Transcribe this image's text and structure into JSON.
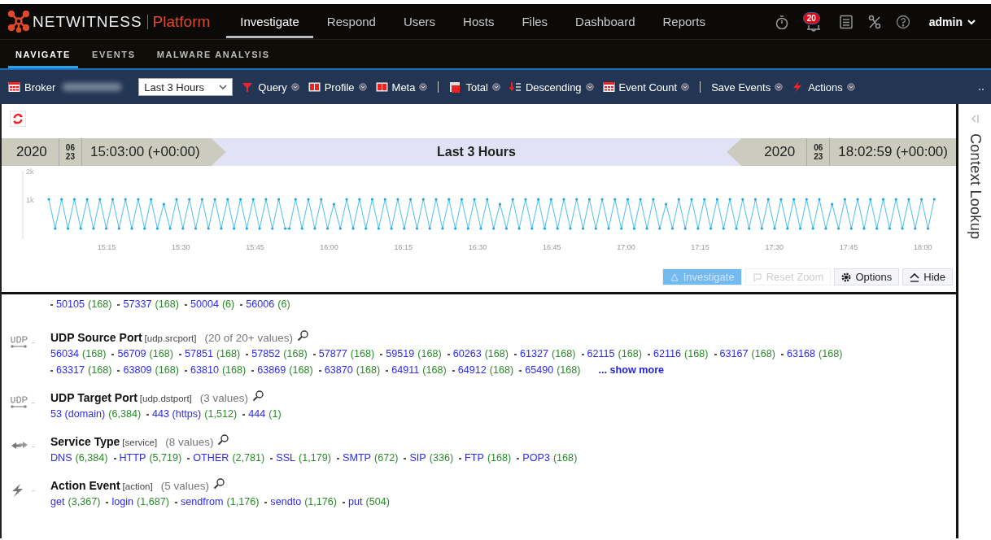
{
  "header": {
    "brand": "NETWITNESS",
    "product": "Platform",
    "nav": [
      {
        "label": "Investigate",
        "selected": true
      },
      {
        "label": "Respond",
        "selected": false
      },
      {
        "label": "Users",
        "selected": false
      },
      {
        "label": "Hosts",
        "selected": false
      },
      {
        "label": "Files",
        "selected": false
      },
      {
        "label": "Dashboard",
        "selected": false
      },
      {
        "label": "Reports",
        "selected": false
      }
    ],
    "notification_count": "20",
    "user": "admin"
  },
  "subnav": [
    {
      "label": "NAVIGATE",
      "selected": true
    },
    {
      "label": "EVENTS",
      "selected": false
    },
    {
      "label": "MALWARE ANALYSIS",
      "selected": false
    }
  ],
  "toolbar": {
    "broker_label": "Broker",
    "time_range": "Last 3 Hours",
    "items": [
      {
        "kind": "funnel",
        "label": "Query"
      },
      {
        "kind": "profile",
        "label": "Profile"
      },
      {
        "kind": "profile",
        "label": "Meta"
      },
      {
        "kind": "separator"
      },
      {
        "kind": "total",
        "label": "Total"
      },
      {
        "kind": "sort",
        "label": "Descending"
      },
      {
        "kind": "grid",
        "label": "Event Count"
      },
      {
        "kind": "separator"
      },
      {
        "kind": "plain",
        "label": "Save Events"
      },
      {
        "kind": "bolt",
        "label": "Actions"
      }
    ]
  },
  "timeline": {
    "start": {
      "year": "2020",
      "month": "06",
      "day": "23",
      "time": "15:03:00 (+00:00)"
    },
    "range_label": "Last 3 Hours",
    "end": {
      "year": "2020",
      "month": "06",
      "day": "23",
      "time": "18:02:59 (+00:00)"
    },
    "y_ticks": [
      "2k",
      "1k"
    ],
    "x_ticks": [
      "15:15",
      "15:30",
      "15:45",
      "16:00",
      "16:15",
      "16:30",
      "16:45",
      "17:00",
      "17:15",
      "17:30",
      "17:45",
      "18:00"
    ],
    "buttons": [
      {
        "kind": "investigate",
        "label": "Investigate",
        "disabled": true,
        "primary": true
      },
      {
        "kind": "reset",
        "label": "Reset Zoom",
        "disabled": true,
        "primary": false
      },
      {
        "kind": "gear",
        "label": "Options",
        "disabled": false,
        "primary": false
      },
      {
        "kind": "hide",
        "label": "Hide",
        "disabled": false,
        "primary": false
      }
    ]
  },
  "meta_groups": [
    {
      "kind": "continuation",
      "values": [
        {
          "value": "50105",
          "count": "(168)"
        },
        {
          "value": "57337",
          "count": "(168)"
        },
        {
          "value": "50004",
          "count": "(6)"
        },
        {
          "value": "56006",
          "count": "(6)"
        }
      ]
    },
    {
      "kind": "udp",
      "title": "UDP Source Port",
      "key": "[udp.srcport]",
      "count": "(20 of 20+ values)",
      "values": [
        {
          "value": "56034",
          "count": "(168)"
        },
        {
          "value": "56709",
          "count": "(168)"
        },
        {
          "value": "57851",
          "count": "(168)"
        },
        {
          "value": "57852",
          "count": "(168)"
        },
        {
          "value": "57877",
          "count": "(168)"
        },
        {
          "value": "59519",
          "count": "(168)"
        },
        {
          "value": "60263",
          "count": "(168)"
        },
        {
          "value": "61327",
          "count": "(168)"
        },
        {
          "value": "62115",
          "count": "(168)"
        },
        {
          "value": "62116",
          "count": "(168)"
        },
        {
          "value": "63167",
          "count": "(168)"
        },
        {
          "value": "63168",
          "count": "(168)"
        },
        {
          "value": "63317",
          "count": "(168)"
        },
        {
          "value": "63809",
          "count": "(168)"
        },
        {
          "value": "63810",
          "count": "(168)"
        },
        {
          "value": "63869",
          "count": "(168)"
        },
        {
          "value": "63870",
          "count": "(168)"
        },
        {
          "value": "64911",
          "count": "(168)"
        },
        {
          "value": "64912",
          "count": "(168)"
        },
        {
          "value": "65490",
          "count": "(168)"
        }
      ],
      "more": "... show more"
    },
    {
      "kind": "udp",
      "title": "UDP Target Port",
      "key": "[udp.dstport]",
      "count": "(3 values)",
      "values": [
        {
          "value": "53 (domain)",
          "count": "(6,384)"
        },
        {
          "value": "443 (https)",
          "count": "(1,512)"
        },
        {
          "value": "444",
          "count": "(1)"
        }
      ]
    },
    {
      "kind": "service",
      "title": "Service Type",
      "key": "[service]",
      "count": "(8 values)",
      "values": [
        {
          "value": "DNS",
          "count": "(6,384)"
        },
        {
          "value": "HTTP",
          "count": "(5,719)"
        },
        {
          "value": "OTHER",
          "count": "(2,781)"
        },
        {
          "value": "SSL",
          "count": "(1,179)"
        },
        {
          "value": "SMTP",
          "count": "(672)"
        },
        {
          "value": "SIP",
          "count": "(336)"
        },
        {
          "value": "FTP",
          "count": "(168)"
        },
        {
          "value": "POP3",
          "count": "(168)"
        }
      ]
    },
    {
      "kind": "action",
      "title": "Action Event",
      "key": "[action]",
      "count": "(5 values)",
      "values": [
        {
          "value": "get",
          "count": "(3,367)"
        },
        {
          "value": "login",
          "count": "(1,687)"
        },
        {
          "value": "sendfrom",
          "count": "(1,176)"
        },
        {
          "value": "sendto",
          "count": "(1,176)"
        },
        {
          "value": "put",
          "count": "(504)"
        }
      ]
    }
  ],
  "context_panel": {
    "title": "Context Lookup"
  }
}
